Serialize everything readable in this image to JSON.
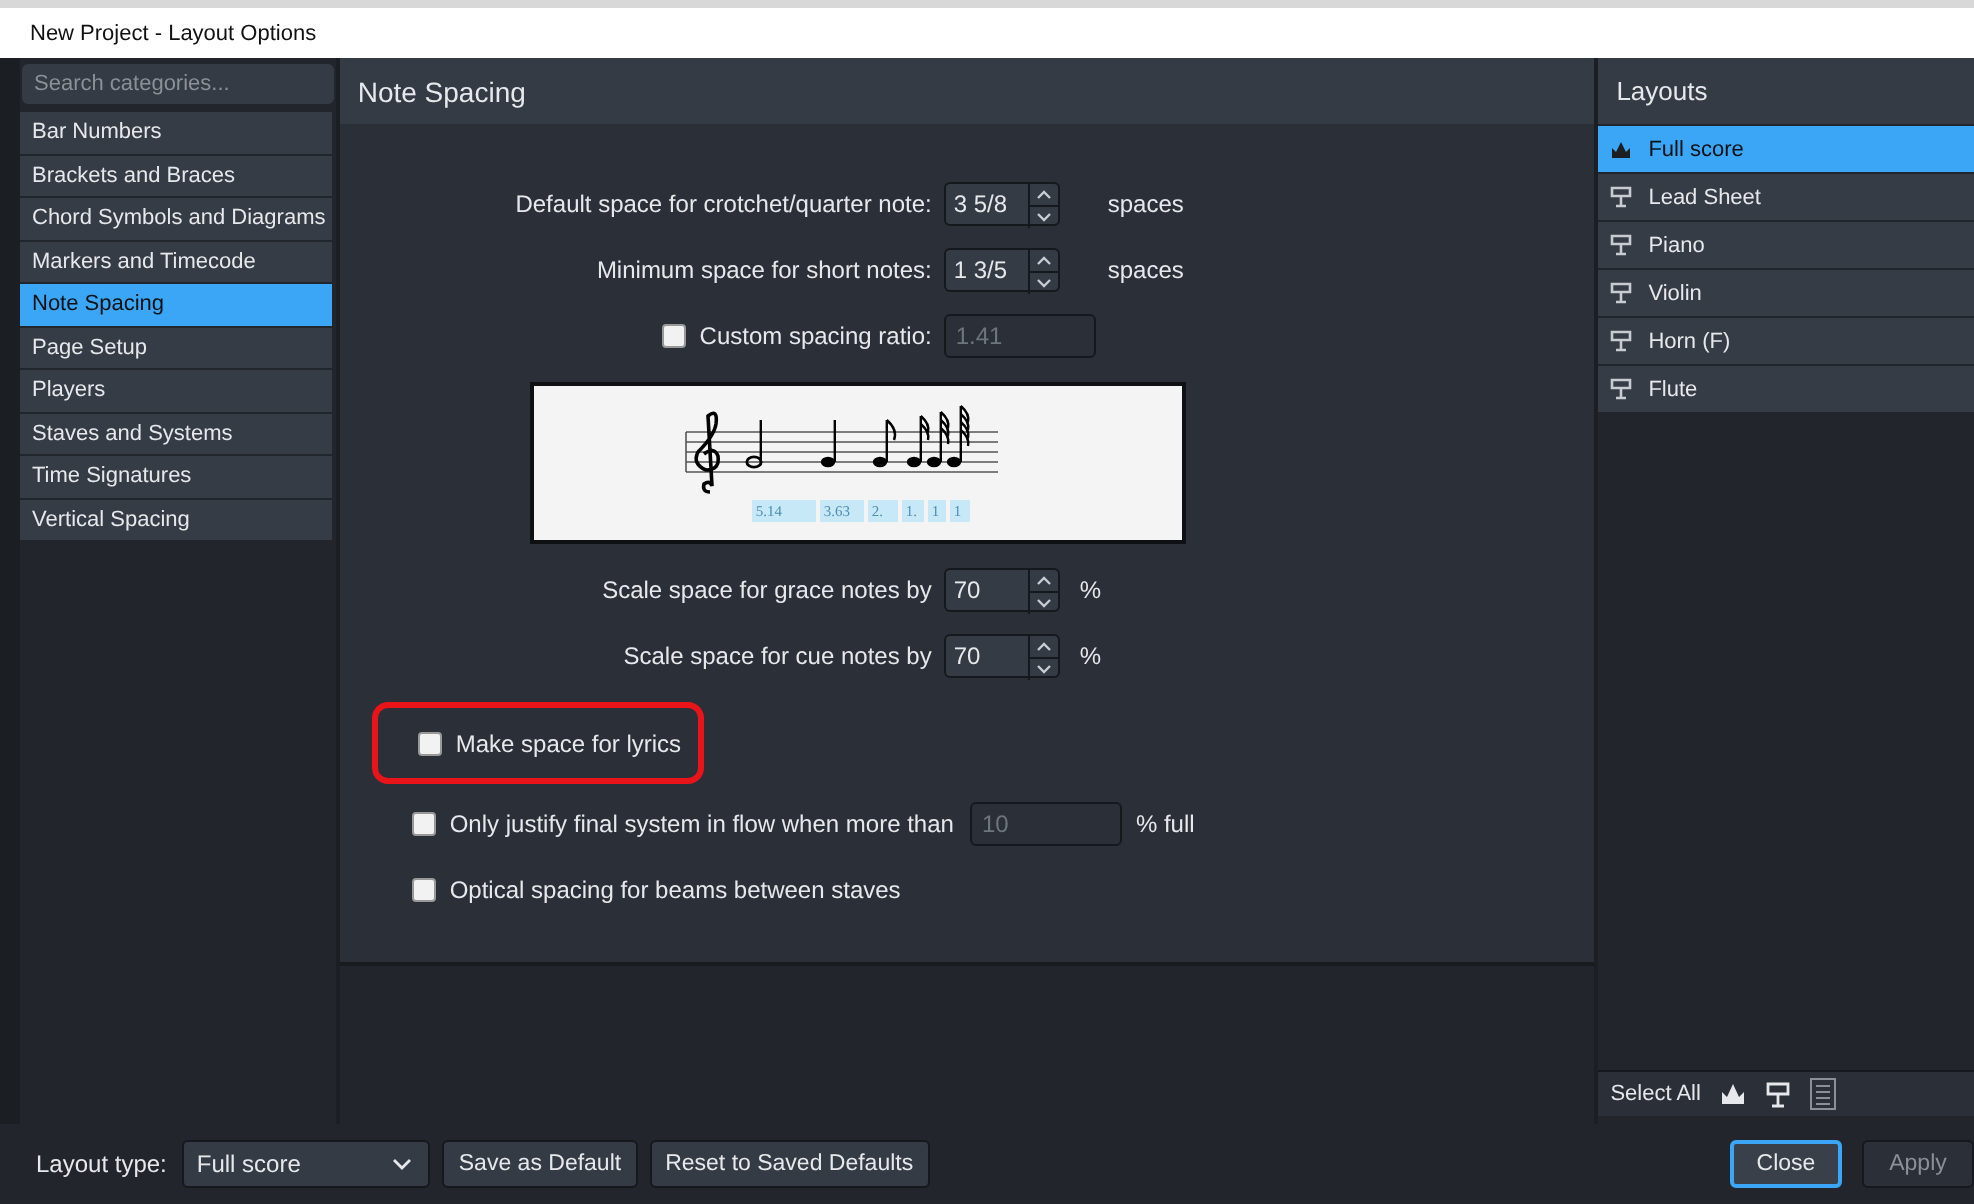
{
  "window": {
    "title": "New Project - Layout Options"
  },
  "sidebar": {
    "search": {
      "placeholder": "Search categories..."
    },
    "items": [
      {
        "label": "Bar Numbers",
        "selected": false
      },
      {
        "label": "Brackets and Braces",
        "selected": false
      },
      {
        "label": "Chord Symbols and Diagrams",
        "selected": false
      },
      {
        "label": "Markers and Timecode",
        "selected": false
      },
      {
        "label": "Note Spacing",
        "selected": true
      },
      {
        "label": "Page Setup",
        "selected": false
      },
      {
        "label": "Players",
        "selected": false
      },
      {
        "label": "Staves and Systems",
        "selected": false
      },
      {
        "label": "Time Signatures",
        "selected": false
      },
      {
        "label": "Vertical Spacing",
        "selected": false
      }
    ]
  },
  "main": {
    "title": "Note Spacing",
    "spinners": [
      {
        "label": "Default space for crotchet/quarter note:",
        "value": "3 5/8",
        "unit": "spaces"
      },
      {
        "label": "Minimum space for short notes:",
        "value": "1 3/5",
        "unit": "spaces"
      }
    ],
    "custom_ratio": {
      "label": "Custom spacing ratio:",
      "checked": false,
      "value": "1.41"
    },
    "preview": {
      "spacing_labels": [
        "5.14",
        "3.63",
        "2.",
        "1.",
        "1",
        "1"
      ]
    },
    "scales": [
      {
        "label": "Scale space for grace notes by",
        "value": "70",
        "unit": "%"
      },
      {
        "label": "Scale space for cue notes by",
        "value": "70",
        "unit": "%"
      }
    ],
    "options": [
      {
        "kind": "checkbox",
        "label": "Make space for lyrics",
        "checked": false,
        "highlighted": true
      },
      {
        "kind": "checkbox-field",
        "label": "Only justify final system in flow when more than",
        "checked": false,
        "highlighted": false,
        "value": "10",
        "suffix": "% full"
      },
      {
        "kind": "checkbox",
        "label": "Optical spacing for beams between staves",
        "checked": false,
        "highlighted": false
      }
    ]
  },
  "layouts": {
    "title": "Layouts",
    "items": [
      {
        "label": "Full score",
        "kind": "score",
        "selected": true
      },
      {
        "label": "Lead Sheet",
        "kind": "part",
        "selected": false
      },
      {
        "label": "Piano",
        "kind": "part",
        "selected": false
      },
      {
        "label": "Violin",
        "kind": "part",
        "selected": false
      },
      {
        "label": "Horn (F)",
        "kind": "part",
        "selected": false
      },
      {
        "label": "Flute",
        "kind": "part",
        "selected": false
      }
    ],
    "select_all": "Select All"
  },
  "footer": {
    "layout_type_label": "Layout type:",
    "layout_type": "Full score",
    "left_buttons": [
      "Save as Default",
      "Reset to Saved Defaults"
    ],
    "right_buttons": [
      {
        "label": "Close",
        "default": true,
        "disabled": false
      },
      {
        "label": "Apply",
        "default": false,
        "disabled": true
      }
    ]
  }
}
